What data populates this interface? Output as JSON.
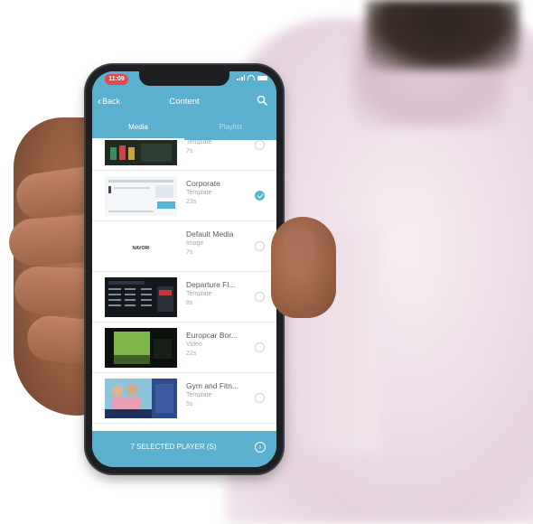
{
  "status": {
    "time": "11:09"
  },
  "nav": {
    "back_label": "Back",
    "title": "Content"
  },
  "tabs": [
    {
      "label": "Media",
      "active": true
    },
    {
      "label": "Playlist",
      "active": false
    }
  ],
  "media_list": [
    {
      "name": "",
      "type": "Template",
      "duration": "7s",
      "selected": false
    },
    {
      "name": "Corporate",
      "type": "Template",
      "duration": "23s",
      "selected": true
    },
    {
      "name": "Default Media",
      "type": "Image",
      "duration": "7s",
      "selected": false
    },
    {
      "name": "Departure Fl...",
      "type": "Template",
      "duration": "8s",
      "selected": false
    },
    {
      "name": "Europcar Bor...",
      "type": "Video",
      "duration": "22s",
      "selected": false
    },
    {
      "name": "Gym and Fitn...",
      "type": "Template",
      "duration": "5s",
      "selected": false
    }
  ],
  "footer": {
    "label": "7 SELECTED PLAYER (S)"
  },
  "thumb_logos": {
    "default_media": "NAVORI"
  },
  "colors": {
    "accent": "#5ab0cd",
    "checked": "#58b3d2",
    "time_badge": "#e8464a"
  },
  "icons": [
    "chevron-left-icon",
    "search-icon",
    "check-icon",
    "arrow-right-circle-icon",
    "signal-icon",
    "wifi-icon",
    "battery-icon"
  ]
}
